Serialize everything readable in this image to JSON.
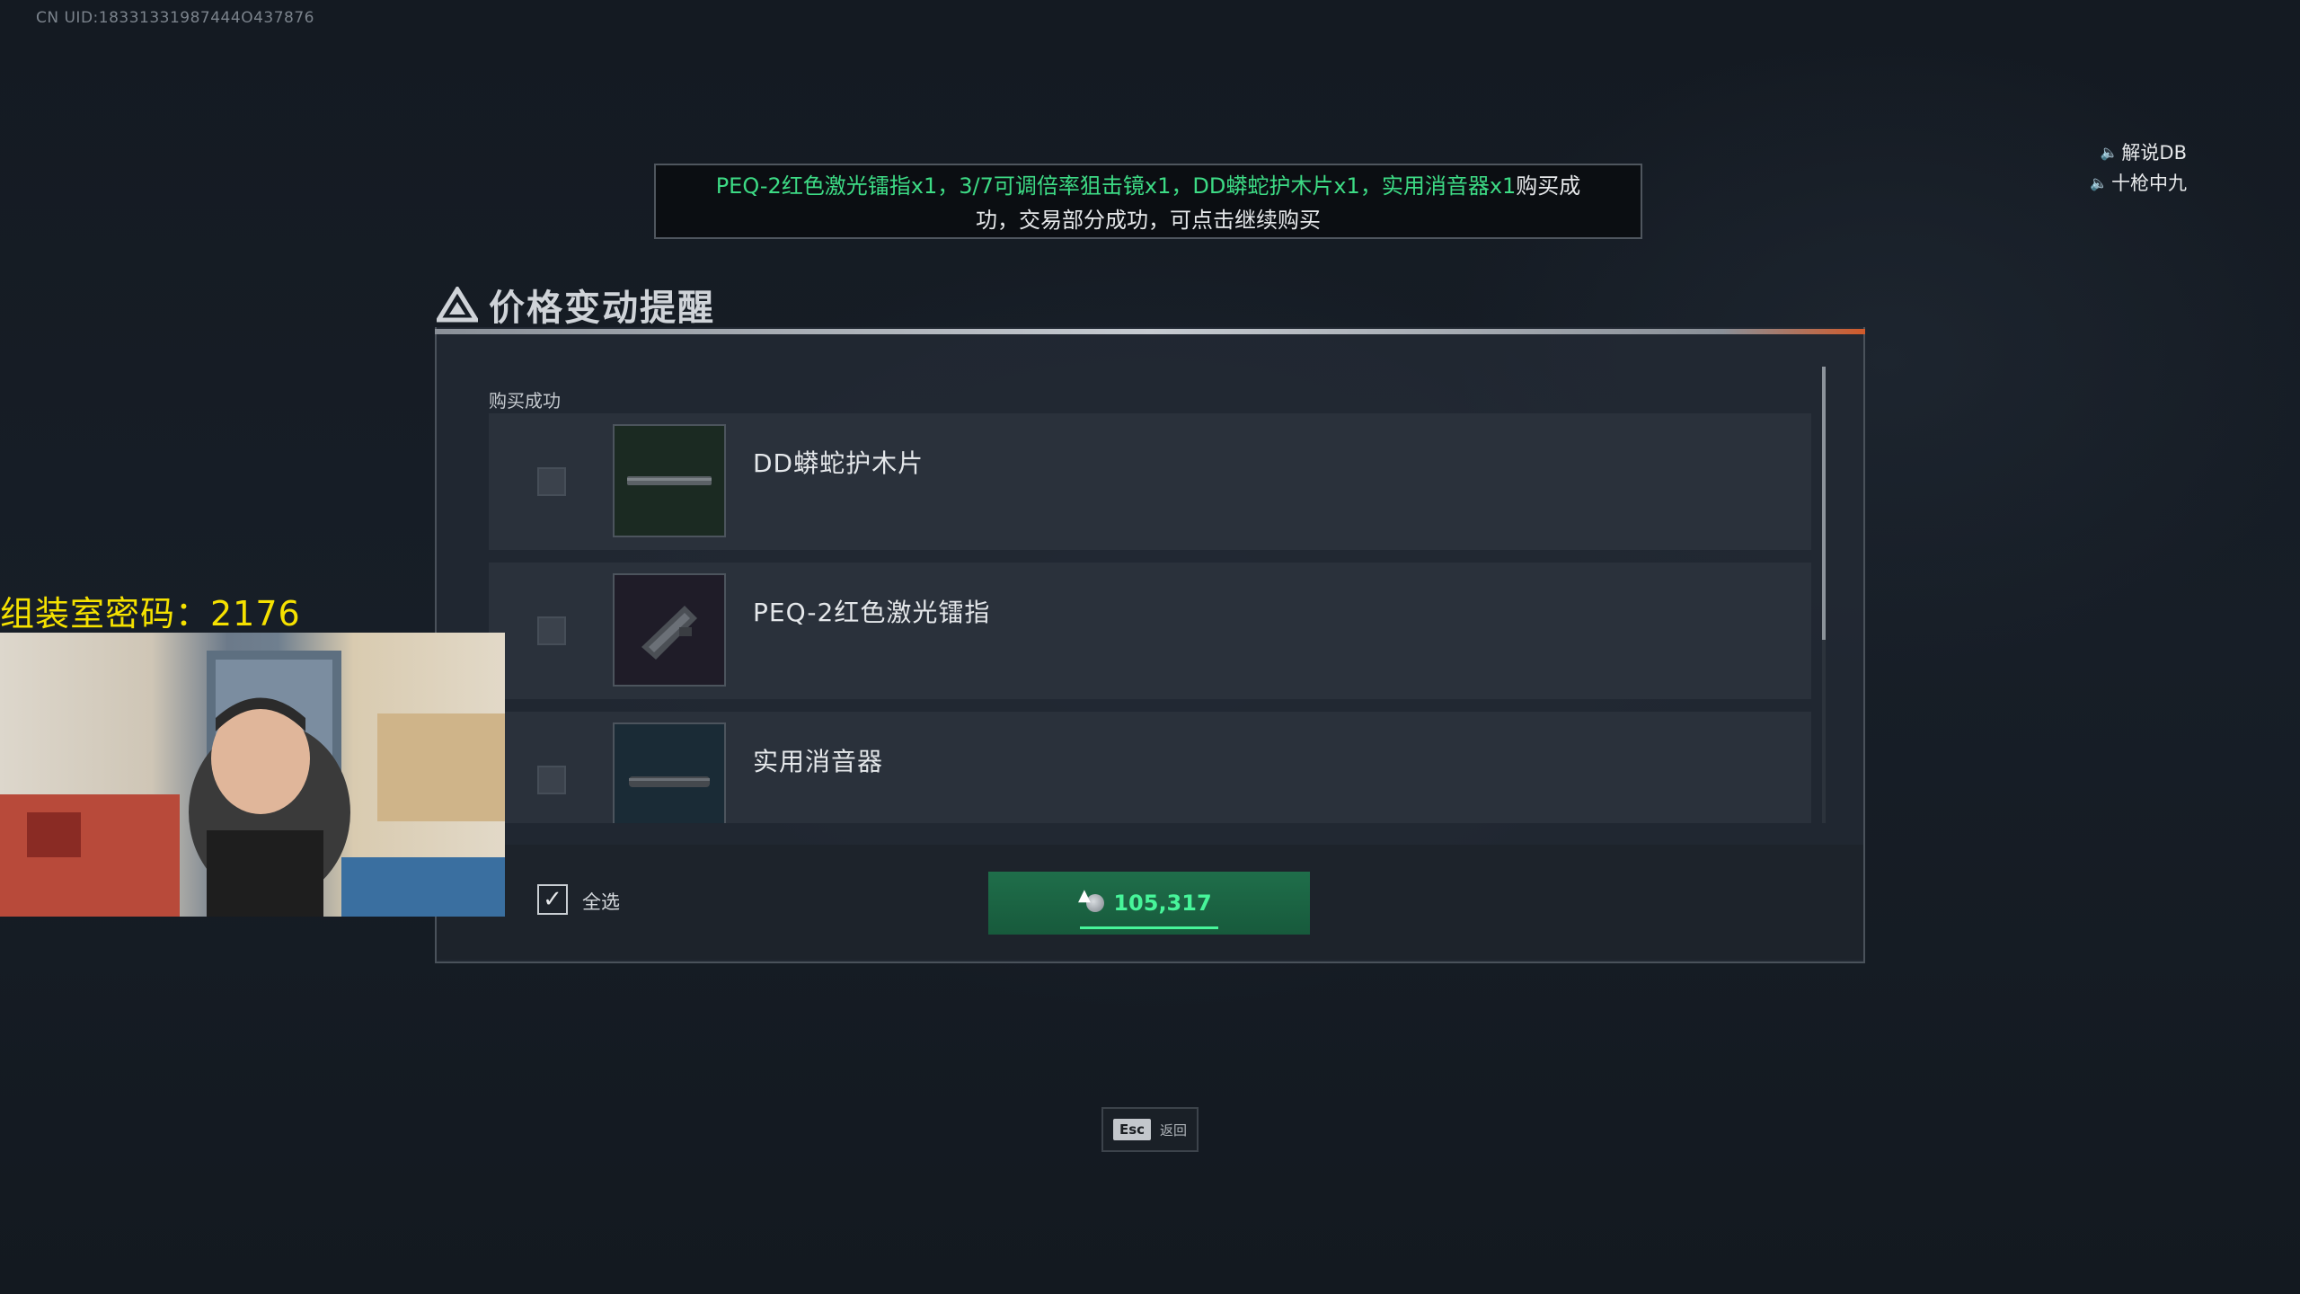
{
  "uid_text": "CN UID:18331331987444O437876",
  "voice_chat": [
    {
      "icon": "speaker-icon",
      "name": "解说DB"
    },
    {
      "icon": "speaker-icon",
      "name": "十枪中九"
    }
  ],
  "notification": {
    "highlight": "PEQ-2红色激光镭指x1，3/7可调倍率狙击镜x1，DD蟒蛇护木片x1，实用消音器x1",
    "line1_rest": "购买成",
    "line2": "功，交易部分成功，可点击继续购买"
  },
  "dialog": {
    "title": "价格变动提醒",
    "section_label": "购买成功",
    "items": [
      {
        "name": "DD蟒蛇护木片",
        "thumb_icon": "handguard-icon",
        "thumb_color": "#1b2a22"
      },
      {
        "name": "PEQ-2红色激光镭指",
        "thumb_icon": "laser-module-icon",
        "thumb_color": "#1f1c28"
      },
      {
        "name": "实用消音器",
        "thumb_icon": "suppressor-icon",
        "thumb_color": "#1a2b36"
      }
    ],
    "select_all_label": "全选",
    "select_all_checked": true,
    "buy_price": "105,317",
    "esc_key": "Esc",
    "esc_label": "返回"
  },
  "stream_overlay": {
    "room_password": "组装室密码：2176"
  },
  "colors": {
    "accent_green": "#3ddb85",
    "price_green": "#47f59a",
    "overlay_yellow": "#f5e100"
  }
}
